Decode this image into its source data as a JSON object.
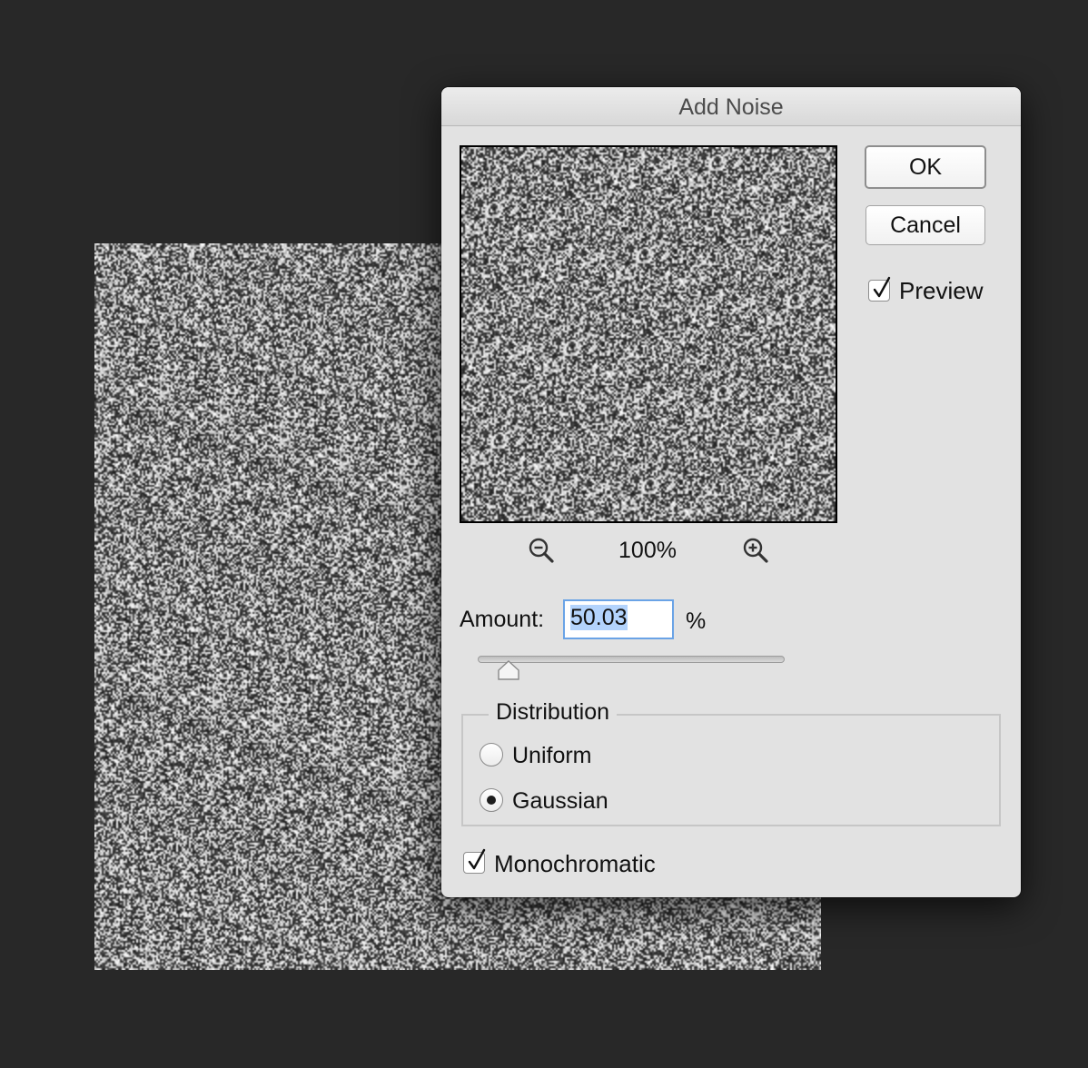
{
  "dialog": {
    "title": "Add Noise",
    "ok_label": "OK",
    "cancel_label": "Cancel",
    "preview": {
      "label": "Preview",
      "checked": true
    },
    "zoom_level": "100%",
    "zoom_out_icon": "zoom-out-magnifier",
    "zoom_in_icon": "zoom-in-magnifier",
    "amount": {
      "label": "Amount:",
      "value": "50.03",
      "unit": "%",
      "slider_fraction": 0.1
    },
    "distribution": {
      "legend": "Distribution",
      "options": [
        {
          "label": "Uniform",
          "selected": false
        },
        {
          "label": "Gaussian",
          "selected": true
        }
      ]
    },
    "monochromatic": {
      "label": "Monochromatic",
      "checked": true
    }
  },
  "colors": {
    "workspace_background": "#282828",
    "dialog_background": "#e2e2e2",
    "input_focus_border": "#6aa3e6",
    "text_selection": "#b3d3fc"
  }
}
